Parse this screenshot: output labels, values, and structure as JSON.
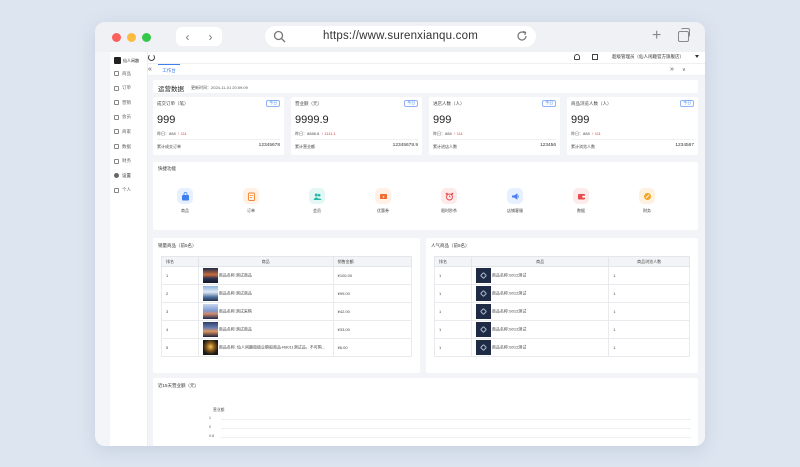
{
  "browser": {
    "url": "https://www.surenxianqu.com",
    "back": "‹",
    "forward": "›",
    "new_tab": "+"
  },
  "app": {
    "logo_text": "仙人闲趣",
    "user_name": "超级管理员（仙人闲趣官方旗舰店）",
    "sidebar": [
      {
        "label": "商品",
        "icon": "product-icon"
      },
      {
        "label": "订单",
        "icon": "order-icon"
      },
      {
        "label": "营销",
        "icon": "marketing-icon"
      },
      {
        "label": "会员",
        "icon": "member-icon"
      },
      {
        "label": "商家",
        "icon": "merchant-icon"
      },
      {
        "label": "数据",
        "icon": "data-icon"
      },
      {
        "label": "财务",
        "icon": "finance-icon"
      },
      {
        "label": "设置",
        "icon": "settings-icon"
      },
      {
        "label": "个人",
        "icon": "person-icon"
      }
    ],
    "tabs": {
      "workbench": "工作台",
      "left_arrow": "«",
      "right_arrow": "»",
      "dropdown": "∨"
    }
  },
  "ops": {
    "title": "运营数据",
    "update_time": "更新时间：2024-11-01 20:09:09"
  },
  "stats": [
    {
      "label": "成交订单（笔）",
      "badge": "今日",
      "value": "999",
      "yesterday_label": "昨日：",
      "yesterday": "888",
      "delta": "↑ 111",
      "total_label": "累计成交订单",
      "total": "12345678"
    },
    {
      "label": "营业额（元）",
      "badge": "今日",
      "value": "9999.9",
      "yesterday_label": "昨日：",
      "yesterday": "8888.8",
      "delta": "↑ 1111.1",
      "total_label": "累计营业额",
      "total": "12345678.9"
    },
    {
      "label": "进店人数（人）",
      "badge": "今日",
      "value": "999",
      "yesterday_label": "昨日：",
      "yesterday": "888",
      "delta": "↑ 111",
      "total_label": "累计进店人数",
      "total": "123456"
    },
    {
      "label": "商品浏览人数（人）",
      "badge": "今日",
      "value": "999",
      "yesterday_label": "昨日：",
      "yesterday": "888",
      "delta": "↑ 111",
      "total_label": "累计浏览人数",
      "total": "1234567"
    }
  ],
  "quick": {
    "title": "快捷功能",
    "items": [
      {
        "label": "商品",
        "icon": "shopping-bag-icon",
        "bg": "#e6f0ff",
        "color": "#3d7ff0"
      },
      {
        "label": "订单",
        "icon": "order-edit-icon",
        "bg": "#fff1e6",
        "color": "#f2842f"
      },
      {
        "label": "会员",
        "icon": "members-icon",
        "bg": "#e3f7f5",
        "color": "#27b8a8"
      },
      {
        "label": "优惠券",
        "icon": "coupon-icon",
        "bg": "#fff1e6",
        "color": "#f06a2a"
      },
      {
        "label": "限时秒杀",
        "icon": "alarm-clock-icon",
        "bg": "#fdeaea",
        "color": "#e94a4a"
      },
      {
        "label": "店铺客服",
        "icon": "megaphone-icon",
        "bg": "#e6f0ff",
        "color": "#4a7ef2"
      },
      {
        "label": "数据",
        "icon": "wallet-icon",
        "bg": "#fdeaea",
        "color": "#e94a4a"
      },
      {
        "label": "财务",
        "icon": "coin-icon",
        "bg": "#fff1e0",
        "color": "#f5a623"
      }
    ]
  },
  "sales_table": {
    "title": "销量商品（前5名）",
    "columns": [
      "排名",
      "商品",
      "销售金额"
    ],
    "rows": [
      {
        "rank": "1",
        "name": "商品名称:测试商品",
        "amount": "¥100.00",
        "thumb": "sunset"
      },
      {
        "rank": "2",
        "name": "商品名称:测试商品",
        "amount": "¥99.00",
        "thumb": "mountain"
      },
      {
        "rank": "3",
        "name": "商品名称:测试采购",
        "amount": "¥42.00",
        "thumb": "lake"
      },
      {
        "rank": "4",
        "name": "商品名称:测试商品",
        "amount": "¥33.00",
        "thumb": "dusk"
      },
      {
        "rank": "5",
        "name": "商品名称: 仙人闲趣南极企鹅船商品-R8011测试品，不可购...",
        "amount": "¥6.00",
        "thumb": "gold"
      }
    ]
  },
  "popular_table": {
    "title": "人气商品（前5名）",
    "columns": [
      "排名",
      "商品",
      "商品浏览人数"
    ],
    "rows": [
      {
        "rank": "1",
        "name": "商品名称:S012测试",
        "views": "1"
      },
      {
        "rank": "1",
        "name": "商品名称:S012测试",
        "views": "1"
      },
      {
        "rank": "1",
        "name": "商品名称:S012测试",
        "views": "1"
      },
      {
        "rank": "1",
        "name": "商品名称:S012测试",
        "views": "1"
      },
      {
        "rank": "1",
        "name": "商品名称:S012测试",
        "views": "1"
      }
    ]
  },
  "trend": {
    "title": "近15天营业额（元）",
    "y_name": "营业额",
    "ticks": [
      "1",
      "0",
      "0.8"
    ]
  }
}
